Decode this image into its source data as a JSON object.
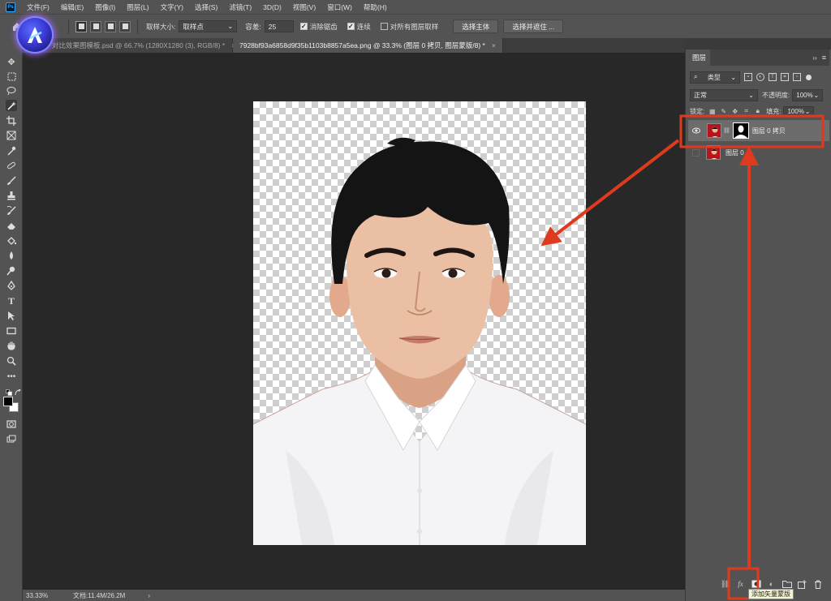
{
  "menubar": {
    "app_icon": "Ps",
    "items": [
      "文件(F)",
      "编辑(E)",
      "图像(I)",
      "图层(L)",
      "文字(Y)",
      "选择(S)",
      "滤镜(T)",
      "3D(D)",
      "视图(V)",
      "窗口(W)",
      "帮助(H)"
    ]
  },
  "options": {
    "sample_size_label": "取样大小:",
    "sample_size_value": "取样点",
    "tolerance_label": "容差:",
    "tolerance_value": "25",
    "antialias_label": "消除锯齿",
    "contiguous_label": "连续",
    "sample_all_label": "对所有图层取样",
    "select_subject": "选择主体",
    "select_mask": "选择并遮住 ..."
  },
  "tabs": [
    {
      "label": "对比效果图模板.psd @ 66.7% (1280X1280 (3), RGB/8) *",
      "close": "×"
    },
    {
      "label": "7928bf93a6858d9f35b1103b8857a5ea.png @ 33.3% (图层 0 拷贝, 图层蒙版/8) *",
      "close": "×"
    }
  ],
  "status": {
    "zoom": "33.33%",
    "doc_info": "文档:11.4M/26.2M",
    "arrow": "›"
  },
  "layers_panel": {
    "tab_label": "图层",
    "collapse": "››",
    "menu": "≡",
    "filter_kind": "类型",
    "blend_mode": "正常",
    "opacity_label": "不透明度:",
    "opacity_value": "100%",
    "lock_label": "锁定:",
    "fill_label": "填充:",
    "fill_value": "100%",
    "layers": [
      {
        "name": "图层 0 拷贝",
        "visible": true,
        "has_mask": true,
        "selected": true
      },
      {
        "name": "图层 0",
        "visible": false,
        "has_mask": false,
        "selected": false
      }
    ]
  },
  "tooltip": "添加矢量蒙版",
  "colors": {
    "accent_red": "#e03a1e",
    "panel_bg": "#535353",
    "canvas_bg": "#282828",
    "shirt": "#f4f4f6",
    "hair": "#141414",
    "skin": "#e8b99c"
  },
  "icons": [
    "home-icon",
    "move-icon",
    "marquee-icon",
    "lasso-icon",
    "magic-wand-icon",
    "crop-icon",
    "frame-icon",
    "eyedropper-icon",
    "healing-icon",
    "brush-icon",
    "stamp-icon",
    "history-brush-icon",
    "eraser-icon",
    "bucket-icon",
    "blur-icon",
    "dodge-icon",
    "pen-icon",
    "type-icon",
    "path-select-icon",
    "rectangle-icon",
    "hand-icon",
    "zoom-icon",
    "more-icon",
    "swap-colors-icon",
    "quick-mask-icon",
    "screen-mode-icon",
    "eye-icon",
    "link-icon",
    "fx-icon",
    "mask-icon",
    "adjustment-icon",
    "folder-icon",
    "new-layer-icon",
    "trash-icon"
  ]
}
